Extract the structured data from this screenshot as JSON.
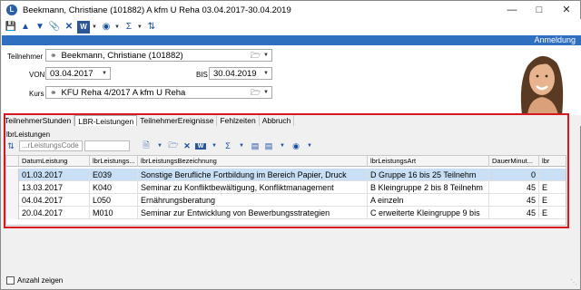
{
  "window": {
    "title": "Beekmann, Christiane (101882)   A kfm U Reha   03.04.2017-30.04.2019",
    "app_icon": "L"
  },
  "header": {
    "band_label": "Anmeldung"
  },
  "form": {
    "teilnehmer_label": "Teilnehmer",
    "teilnehmer_value": "Beekmann, Christiane (101882)",
    "von_label": "VON",
    "von_value": "03.04.2017",
    "bis_label": "BIS",
    "bis_value": "30.04.2019",
    "kurs_label": "Kurs",
    "kurs_value": "KFU Reha 4/2017 A kfm U Reha"
  },
  "tabs": [
    {
      "label": "TeilnehmerStunden"
    },
    {
      "label": "LBR-Leistungen"
    },
    {
      "label": "TeilnehmerEreignisse"
    },
    {
      "label": "Fehlzeiten"
    },
    {
      "label": "Abbruch"
    }
  ],
  "section": {
    "title": "lbrLeistungen",
    "filter_placeholder": "...rLeistungsCode"
  },
  "grid": {
    "columns": [
      "DatumLeistung",
      "lbrLeistungs...",
      "lbrLeistungsBezeichnung",
      "lbrLeistungsArt",
      "DauerMinut...",
      "lbr"
    ],
    "rows": [
      {
        "datum": "01.03.2017",
        "code": "E039",
        "bez": "Sonstige Berufliche Fortbildung im Bereich Papier, Druck",
        "art": "D  Gruppe 16 bis 25 Teilnehm",
        "dauer": "0",
        "lbr": ""
      },
      {
        "datum": "13.03.2017",
        "code": "K040",
        "bez": "Seminar zu Konfliktbewältigung, Konfliktmanagement",
        "art": "B  Kleingruppe 2 bis 8 Teilnehm",
        "dauer": "45",
        "lbr": "E"
      },
      {
        "datum": "04.04.2017",
        "code": "L050",
        "bez": "Ernährungsberatung",
        "art": "A  einzeln",
        "dauer": "45",
        "lbr": "E"
      },
      {
        "datum": "20.04.2017",
        "code": "M010",
        "bez": "Seminar zur Entwicklung von Bewerbungsstrategien",
        "art": "C  erweiterte Kleingruppe 9 bis",
        "dauer": "45",
        "lbr": "E"
      }
    ]
  },
  "footer": {
    "anzahl_label": "Anzahl zeigen"
  }
}
